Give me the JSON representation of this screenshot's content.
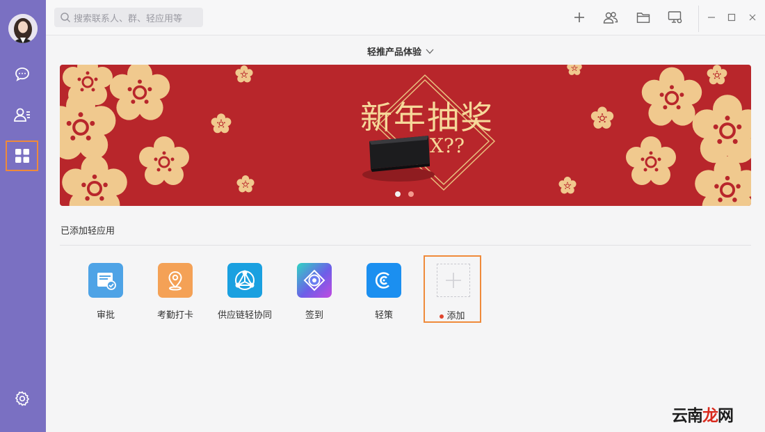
{
  "search": {
    "placeholder": "搜索联系人、群、轻应用等"
  },
  "product_selector": {
    "label": "轻推产品体验"
  },
  "banner": {
    "headline": "新年抽奖",
    "prize_text": "X??",
    "active_slide": 1,
    "slide_count": 2
  },
  "section": {
    "title": "已添加轻应用"
  },
  "apps": [
    {
      "label": "审批",
      "icon": "approval-icon",
      "color": "#4ea3e6"
    },
    {
      "label": "考勤打卡",
      "icon": "location-pin-icon",
      "color": "#f4a156"
    },
    {
      "label": "供应链轻协同",
      "icon": "supply-chain-icon",
      "color": "#1aa0e0"
    },
    {
      "label": "签到",
      "icon": "checkin-icon",
      "color": "#6d5ee8"
    },
    {
      "label": "轻策",
      "icon": "qingce-icon",
      "color": "#1b8ff0"
    }
  ],
  "add_app": {
    "label": "添加"
  },
  "watermark": {
    "part1": "云南",
    "part2": "龙",
    "part3": "网"
  },
  "colors": {
    "sidebar": "#7a70c2",
    "highlight": "#ef8a3a",
    "banner_red": "#b8262b",
    "flower": "#f0c98e"
  }
}
